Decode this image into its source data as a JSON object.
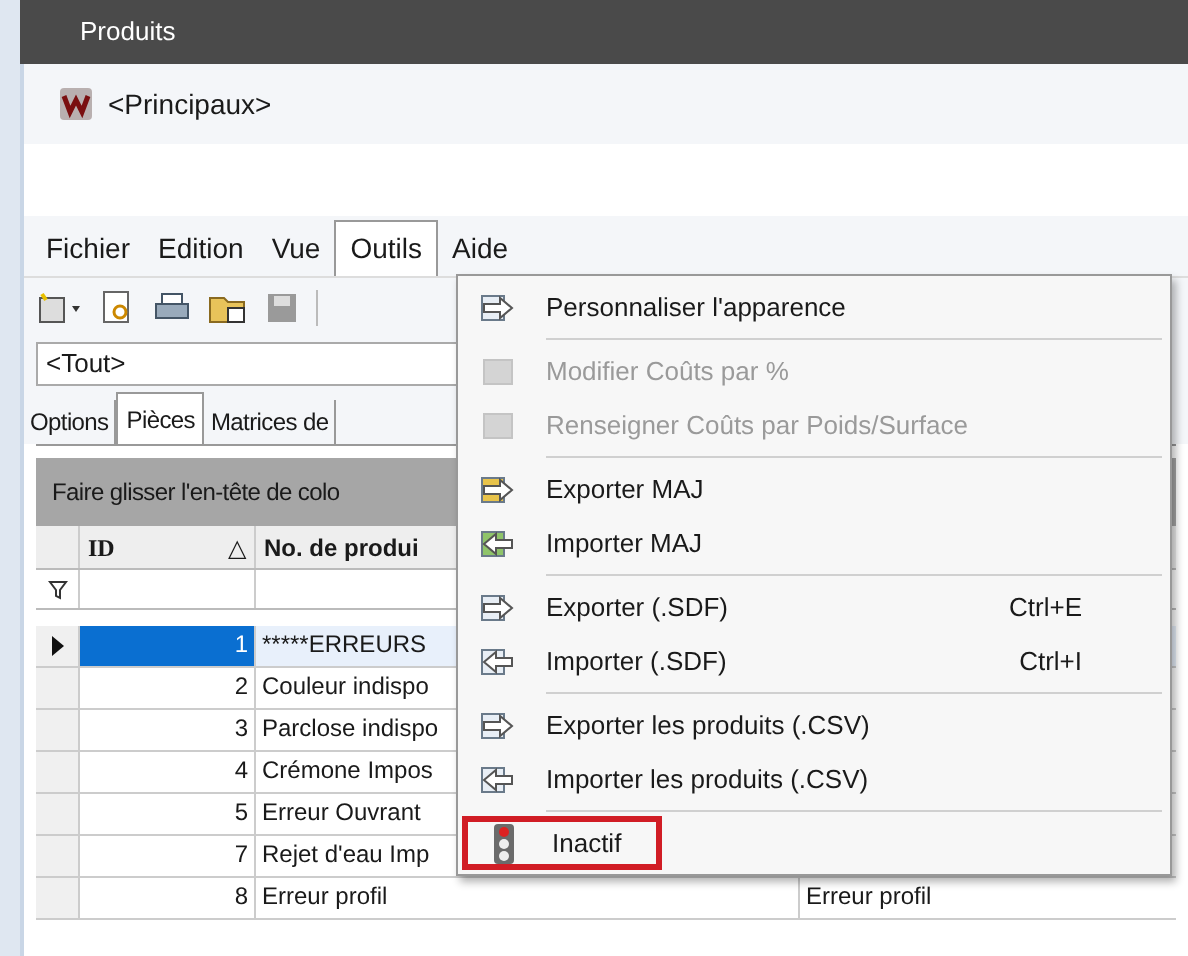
{
  "window": {
    "title": "Produits"
  },
  "header": {
    "title": "<Principaux>"
  },
  "menu_bar": [
    {
      "label": "Fichier",
      "selected": false
    },
    {
      "label": "Edition",
      "selected": false
    },
    {
      "label": "Vue",
      "selected": false
    },
    {
      "label": "Outils",
      "selected": true
    },
    {
      "label": "Aide",
      "selected": false
    }
  ],
  "filter_combo": {
    "value": "<Tout>"
  },
  "tabs": [
    {
      "label": "Options",
      "selected": false
    },
    {
      "label": "Pièces",
      "selected": true
    },
    {
      "label": "Matrices de",
      "selected": false
    }
  ],
  "grid": {
    "group_panel": "Faire glisser l'en-tête de colo",
    "columns": [
      {
        "label": "ID",
        "sort": "△"
      },
      {
        "label": "No. de produi"
      }
    ],
    "rows": [
      {
        "id": "1",
        "product": "*****ERREURS",
        "selected": true
      },
      {
        "id": "2",
        "product": "Couleur indispo",
        "selected": false
      },
      {
        "id": "3",
        "product": "Parclose indispo",
        "selected": false
      },
      {
        "id": "4",
        "product": "Crémone Impos",
        "selected": false
      },
      {
        "id": "5",
        "product": "Erreur Ouvrant",
        "selected": false
      },
      {
        "id": "7",
        "product": "Rejet d'eau Imp",
        "selected": false
      },
      {
        "id": "8",
        "product": "Erreur profil",
        "column_3": "Erreur profil",
        "selected": false
      }
    ]
  },
  "dropdown": [
    {
      "kind": "item",
      "label": "Personnaliser l'apparence",
      "disabled": false,
      "highlighted": false
    },
    {
      "kind": "separator"
    },
    {
      "kind": "item",
      "label": "Modifier Coûts par %",
      "disabled": true,
      "highlighted": false
    },
    {
      "kind": "item",
      "label": "Renseigner Coûts par Poids/Surface",
      "disabled": true,
      "highlighted": false
    },
    {
      "kind": "separator"
    },
    {
      "kind": "item",
      "label": "Exporter MAJ",
      "disabled": false,
      "highlighted": false
    },
    {
      "kind": "item",
      "label": "Importer MAJ",
      "disabled": false,
      "highlighted": false
    },
    {
      "kind": "separator"
    },
    {
      "kind": "item",
      "label": "Exporter (.SDF)",
      "shortcut": "Ctrl+E",
      "disabled": false,
      "highlighted": false
    },
    {
      "kind": "item",
      "label": "Importer (.SDF)",
      "shortcut": "Ctrl+I",
      "disabled": false,
      "highlighted": false
    },
    {
      "kind": "separator"
    },
    {
      "kind": "item",
      "label": "Exporter les produits (.CSV)",
      "disabled": false,
      "highlighted": false
    },
    {
      "kind": "item",
      "label": "Importer les produits (.CSV)",
      "disabled": false,
      "highlighted": false
    },
    {
      "kind": "separator"
    },
    {
      "kind": "item",
      "label": "Inactif",
      "disabled": false,
      "highlighted": true
    }
  ]
}
